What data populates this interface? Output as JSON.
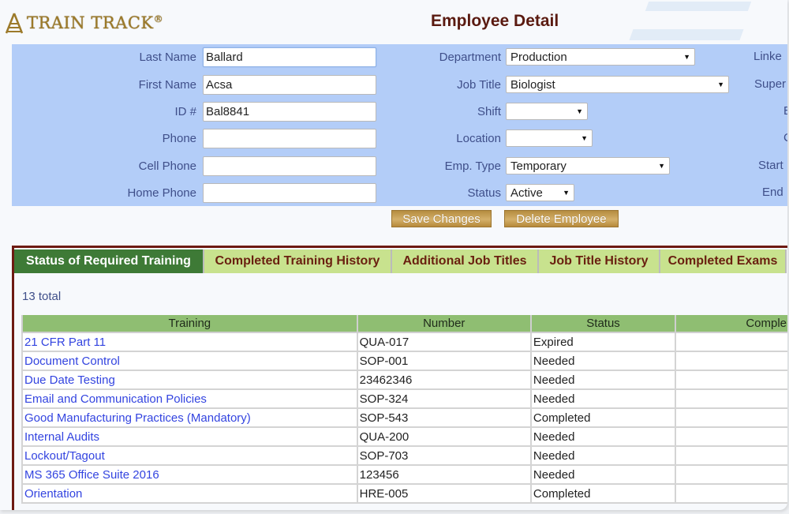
{
  "header": {
    "logo_text": "TRAIN TRACK",
    "logo_mark": "®",
    "title": "Employee Detail"
  },
  "form": {
    "left": [
      {
        "label": "Last Name",
        "value": "Ballard"
      },
      {
        "label": "First Name",
        "value": "Acsa"
      },
      {
        "label": "ID #",
        "value": "Bal8841"
      },
      {
        "label": "Phone",
        "value": ""
      },
      {
        "label": "Cell Phone",
        "value": ""
      },
      {
        "label": "Home Phone",
        "value": ""
      }
    ],
    "middle": [
      {
        "label": "Department",
        "value": "Production"
      },
      {
        "label": "Job Title",
        "value": "Biologist"
      },
      {
        "label": "Shift",
        "value": ""
      },
      {
        "label": "Location",
        "value": ""
      },
      {
        "label": "Emp. Type",
        "value": "Temporary"
      },
      {
        "label": "Status",
        "value": "Active"
      }
    ],
    "right_labels_clipped": [
      "Linke",
      "Super",
      "E",
      "C",
      "Start",
      "End"
    ]
  },
  "actions": {
    "save_label": "Save Changes",
    "delete_label": "Delete Employee"
  },
  "tabs": [
    {
      "label": "Status of Required Training",
      "active": true
    },
    {
      "label": "Completed Training History",
      "active": false
    },
    {
      "label": "Additional Job Titles",
      "active": false
    },
    {
      "label": "Job Title History",
      "active": false
    },
    {
      "label": "Completed Exams",
      "active": false
    }
  ],
  "training": {
    "total_text": "13 total",
    "columns": [
      "Training",
      "Number",
      "Status",
      "Comple"
    ],
    "rows": [
      {
        "training": "21 CFR Part 11",
        "number": "QUA-017",
        "status": "Expired",
        "completed": ""
      },
      {
        "training": "Document Control",
        "number": "SOP-001",
        "status": "Needed",
        "completed": ""
      },
      {
        "training": "Due Date Testing",
        "number": "23462346",
        "status": "Needed",
        "completed": ""
      },
      {
        "training": "Email and Communication Policies",
        "number": "SOP-324",
        "status": "Needed",
        "completed": ""
      },
      {
        "training": "Good Manufacturing Practices (Mandatory)",
        "number": "SOP-543",
        "status": "Completed",
        "completed": ""
      },
      {
        "training": "Internal Audits",
        "number": "QUA-200",
        "status": "Needed",
        "completed": ""
      },
      {
        "training": "Lockout/Tagout",
        "number": "SOP-703",
        "status": "Needed",
        "completed": ""
      },
      {
        "training": "MS 365 Office Suite 2016",
        "number": "123456",
        "status": "Needed",
        "completed": ""
      },
      {
        "training": "Orientation",
        "number": "HRE-005",
        "status": "Completed",
        "completed": ""
      }
    ]
  },
  "colors": {
    "form_bg": "#b3cdf8",
    "label": "#3f4f8a",
    "tab_active": "#3e7a36",
    "tab_inactive": "#c8e28e",
    "tab_text": "#6a2010",
    "frame": "#6e1a12",
    "table_header": "#8fbe72",
    "link": "#3344e0",
    "button": "#c9a052",
    "title": "#5a1a10"
  }
}
